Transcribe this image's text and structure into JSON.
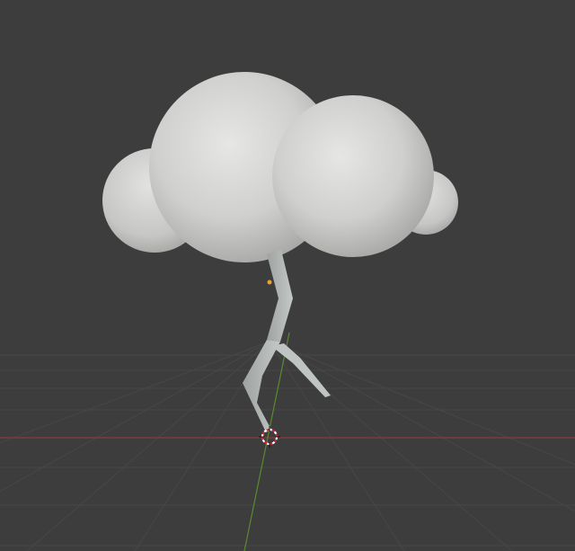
{
  "viewport": {
    "background_color": "#3d3d3d",
    "grid_color": "#4a4a4a",
    "x_axis_color": "#8a3a44",
    "y_axis_color": "#5a8a2e"
  },
  "scene": {
    "objects": [
      {
        "name": "cloud",
        "type": "mesh",
        "material_color": "#d8d8d6"
      },
      {
        "name": "lightning-bolt",
        "type": "mesh",
        "material_color": "#b8bcba"
      }
    ],
    "origin_marker_color": "#f0a030",
    "cursor_3d_icon": "3d-cursor-icon"
  }
}
